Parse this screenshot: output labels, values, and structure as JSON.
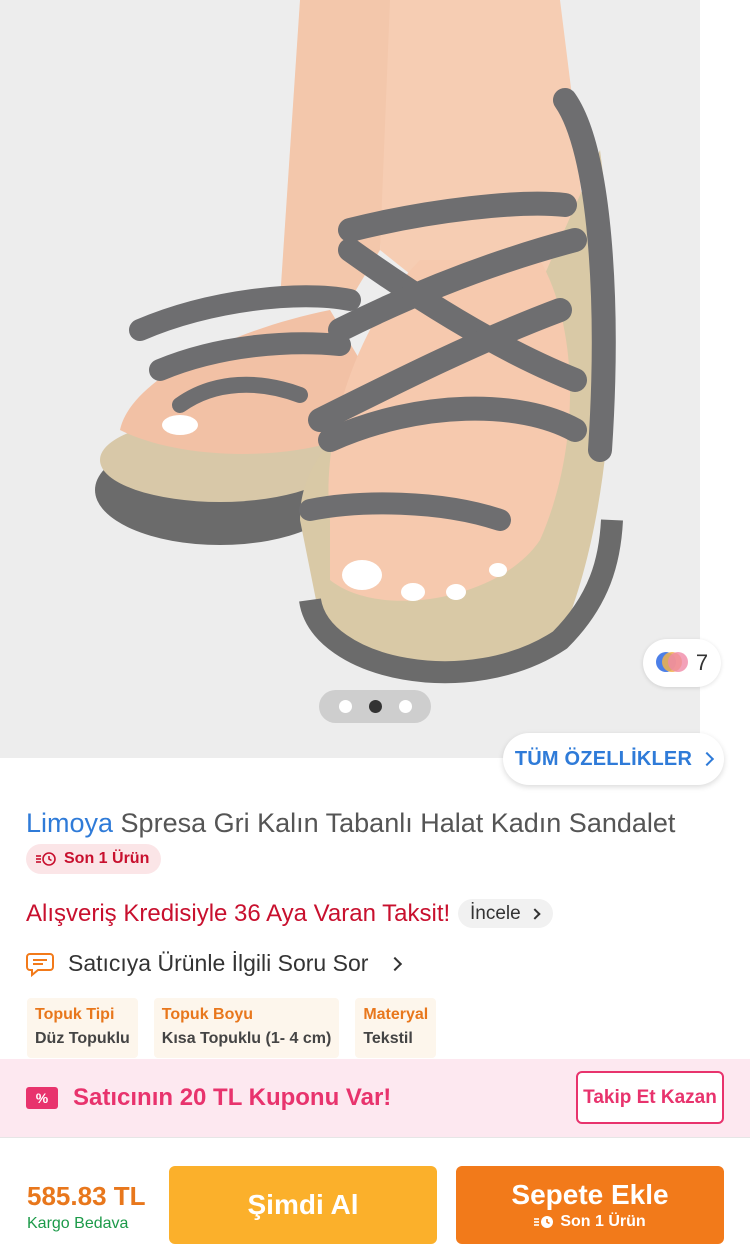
{
  "product": {
    "brand": "Limoya",
    "name": " Spresa Gri Kalın Tabanlı Halat Kadın Sandalet",
    "stock_badge": "Son 1 Ürün",
    "image_alt": "Gray rope platform sandal on foot"
  },
  "gallery": {
    "color_count": "7",
    "dots": 3,
    "active_dot": 1
  },
  "features_button": "TÜM ÖZELLİKLER",
  "credit": {
    "text": "Alışveriş Kredisiyle 36 Aya Varan Taksit!",
    "link": "İncele"
  },
  "ask_seller": "Satıcıya Ürünle İlgili Soru Sor",
  "attributes": [
    {
      "key": "Topuk Tipi",
      "value": "Düz Topuklu"
    },
    {
      "key": "Topuk Boyu",
      "value": "Kısa Topuklu (1- 4 cm)"
    },
    {
      "key": "Materyal",
      "value": "Tekstil"
    }
  ],
  "coupon": {
    "icon_symbol": "%",
    "text": "Satıcının 20 TL Kuponu Var!",
    "button": "Takip Et Kazan"
  },
  "footer": {
    "price": "585.83 TL",
    "shipping": "Kargo Bedava",
    "buy_now": "Şimdi Al",
    "add_to_cart": "Sepete Ekle",
    "add_to_cart_note": "Son 1 Ürün"
  },
  "colors": {
    "accent_orange": "#f27a1a",
    "buy_yellow": "#fbb02b",
    "brand_blue": "#2f7bd8",
    "red": "#c8102e",
    "pink": "#e8336d",
    "green": "#1c9a49"
  }
}
